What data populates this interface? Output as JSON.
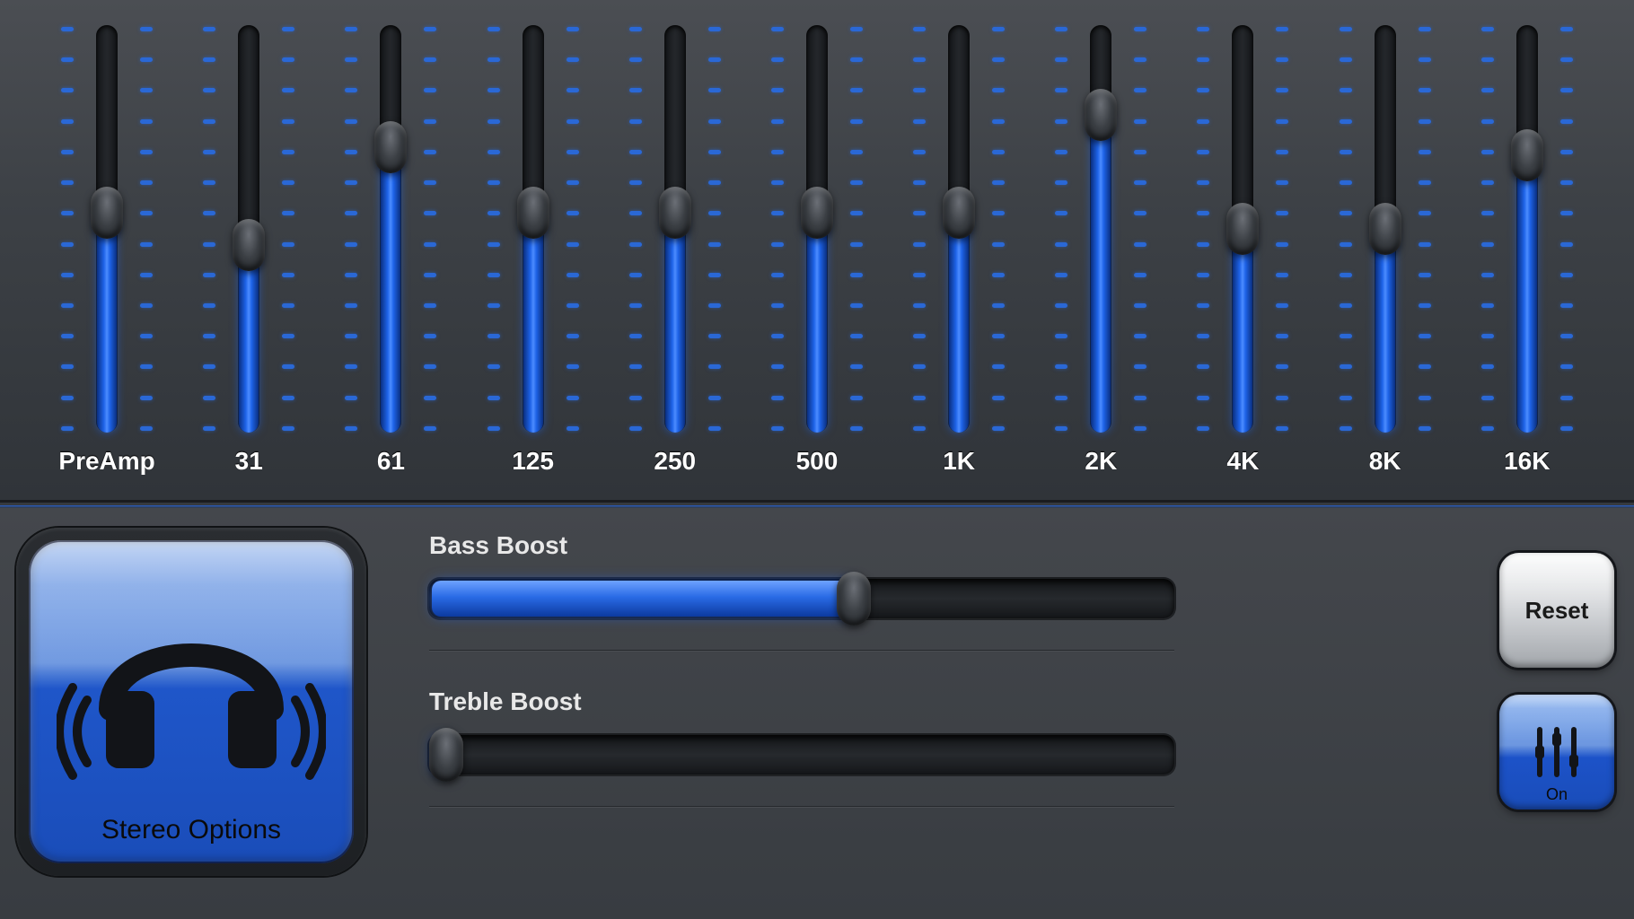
{
  "equalizer": {
    "bands": [
      {
        "label": "PreAmp",
        "value": 0.54
      },
      {
        "label": "31",
        "value": 0.46
      },
      {
        "label": "61",
        "value": 0.7
      },
      {
        "label": "125",
        "value": 0.54
      },
      {
        "label": "250",
        "value": 0.54
      },
      {
        "label": "500",
        "value": 0.54
      },
      {
        "label": "1K",
        "value": 0.54
      },
      {
        "label": "2K",
        "value": 0.78
      },
      {
        "label": "4K",
        "value": 0.5
      },
      {
        "label": "8K",
        "value": 0.5
      },
      {
        "label": "16K",
        "value": 0.68
      }
    ],
    "tick_count": 14
  },
  "boosts": {
    "bass": {
      "title": "Bass Boost",
      "value": 0.57
    },
    "treble": {
      "title": "Treble Boost",
      "value": 0.02
    }
  },
  "stereo_button": {
    "label": "Stereo Options"
  },
  "buttons": {
    "reset": "Reset",
    "on": "On"
  },
  "colors": {
    "accent": "#1e63e8",
    "track": "#1c1f23"
  }
}
